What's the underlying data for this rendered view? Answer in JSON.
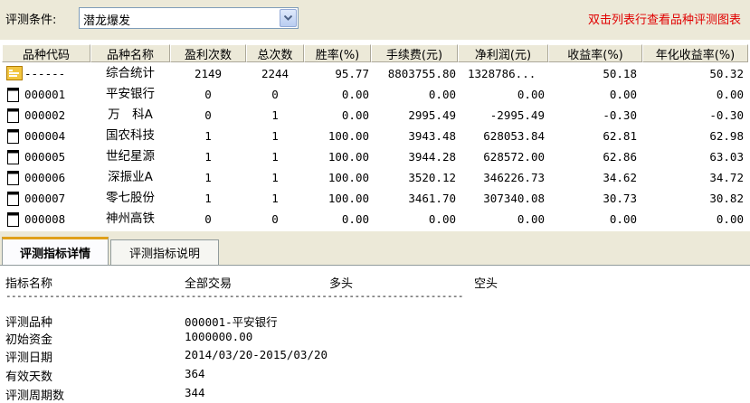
{
  "toolbar": {
    "condition_label": "评测条件:",
    "condition_value": "潜龙爆发",
    "hint": "双击列表行查看品种评测图表"
  },
  "table": {
    "columns": [
      "品种代码",
      "品种名称",
      "盈利次数",
      "总次数",
      "胜率(%)",
      "手续费(元)",
      "净利润(元)",
      "收益率(%)",
      "年化收益率(%)"
    ],
    "rows": [
      [
        "------",
        "综合统计",
        "2149",
        "2244",
        "95.77",
        "8803755.80",
        "1328786...",
        "50.18",
        "50.32"
      ],
      [
        "000001",
        "平安银行",
        "0",
        "0",
        "0.00",
        "0.00",
        "0.00",
        "0.00",
        "0.00"
      ],
      [
        "000002",
        "万　科A",
        "0",
        "1",
        "0.00",
        "2995.49",
        "-2995.49",
        "-0.30",
        "-0.30"
      ],
      [
        "000004",
        "国农科技",
        "1",
        "1",
        "100.00",
        "3943.48",
        "628053.84",
        "62.81",
        "62.98"
      ],
      [
        "000005",
        "世纪星源",
        "1",
        "1",
        "100.00",
        "3944.28",
        "628572.00",
        "62.86",
        "63.03"
      ],
      [
        "000006",
        "深振业A",
        "1",
        "1",
        "100.00",
        "3520.12",
        "346226.73",
        "34.62",
        "34.72"
      ],
      [
        "000007",
        "零七股份",
        "1",
        "1",
        "100.00",
        "3461.70",
        "307340.08",
        "30.73",
        "30.82"
      ],
      [
        "000008",
        "神州高铁",
        "0",
        "0",
        "0.00",
        "0.00",
        "0.00",
        "0.00",
        "0.00"
      ]
    ]
  },
  "tabs": [
    "评测指标详情",
    "评测指标说明"
  ],
  "detail": {
    "headers": [
      "指标名称",
      "全部交易",
      "多头",
      "空头"
    ],
    "separator": "------------------------------------------------------------------------------------",
    "items": [
      {
        "label": "评测品种",
        "value": "000001-平安银行"
      },
      {
        "label": "初始资金",
        "value": "1000000.00"
      },
      {
        "label": "评测日期",
        "value": "2014/03/20-2015/03/20"
      },
      {
        "label": "有效天数",
        "value": "364"
      },
      {
        "label": "评测周期数",
        "value": "344"
      }
    ]
  },
  "colors": {
    "hint": "#e00000",
    "chrome": "#ece9d8",
    "tab_accent": "#e0a01a"
  },
  "icons": {
    "summary_row": "folder-summary-icon",
    "stock_row": "document-icon",
    "combo": "chevron-down-icon"
  }
}
